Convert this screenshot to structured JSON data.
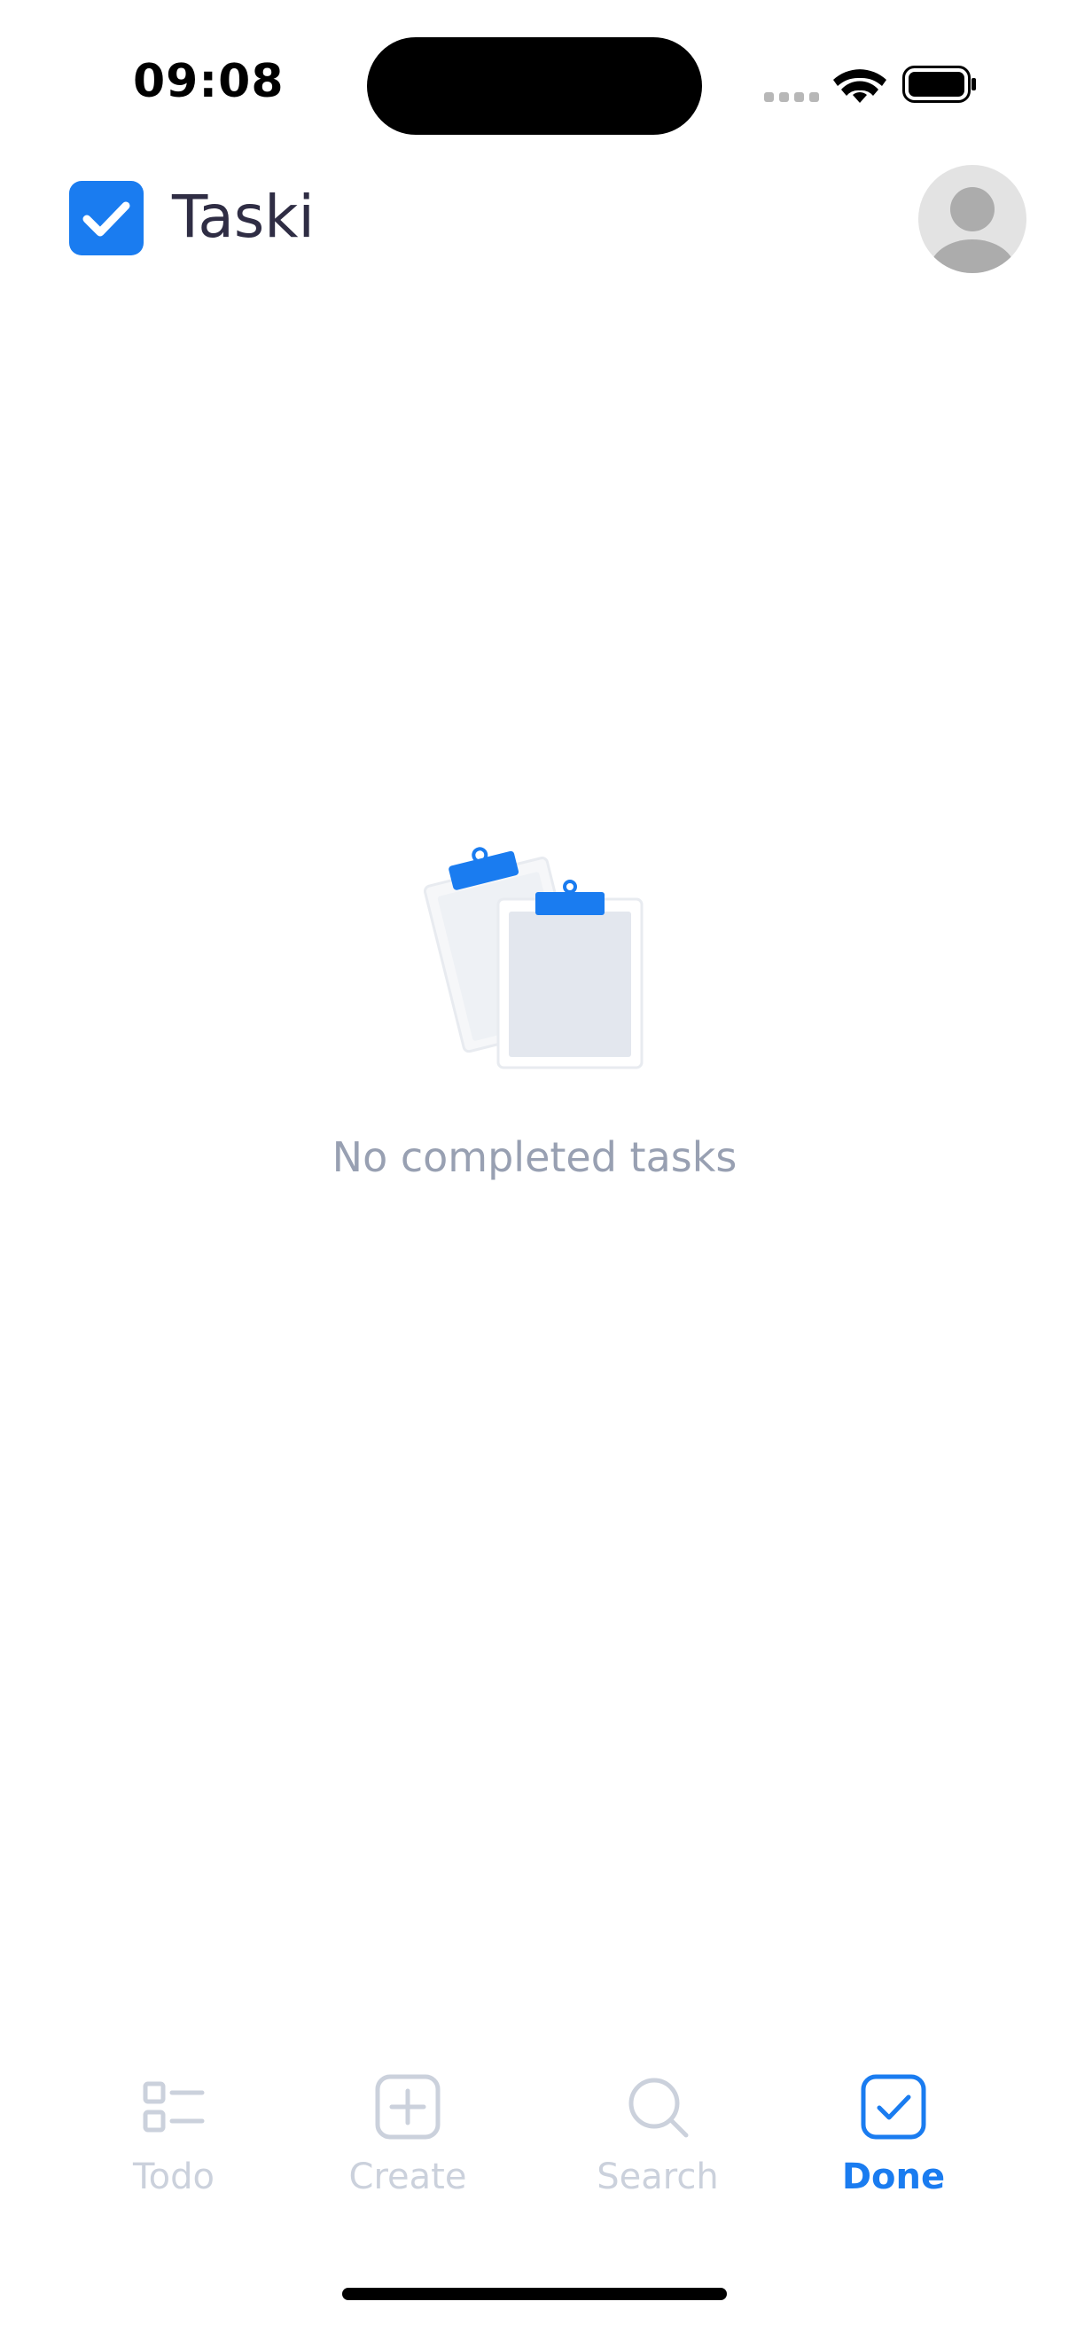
{
  "status_bar": {
    "time": "09:08"
  },
  "header": {
    "app_name": "Taski",
    "logo_icon": "checkbox-checked-icon",
    "avatar_icon": "user-avatar-icon"
  },
  "empty_state": {
    "icon": "clipboards-illustration",
    "message": "No completed tasks"
  },
  "tabs": [
    {
      "label": "Todo",
      "icon": "list-icon",
      "active": false
    },
    {
      "label": "Create",
      "icon": "plus-square-icon",
      "active": false
    },
    {
      "label": "Search",
      "icon": "search-icon",
      "active": false
    },
    {
      "label": "Done",
      "icon": "check-square-icon",
      "active": true
    }
  ],
  "colors": {
    "accent": "#1a7cf0",
    "title_text": "#2f2d44",
    "muted_text": "#98a0b2",
    "inactive_tab": "#cbd1dc",
    "background": "#ffffff"
  }
}
